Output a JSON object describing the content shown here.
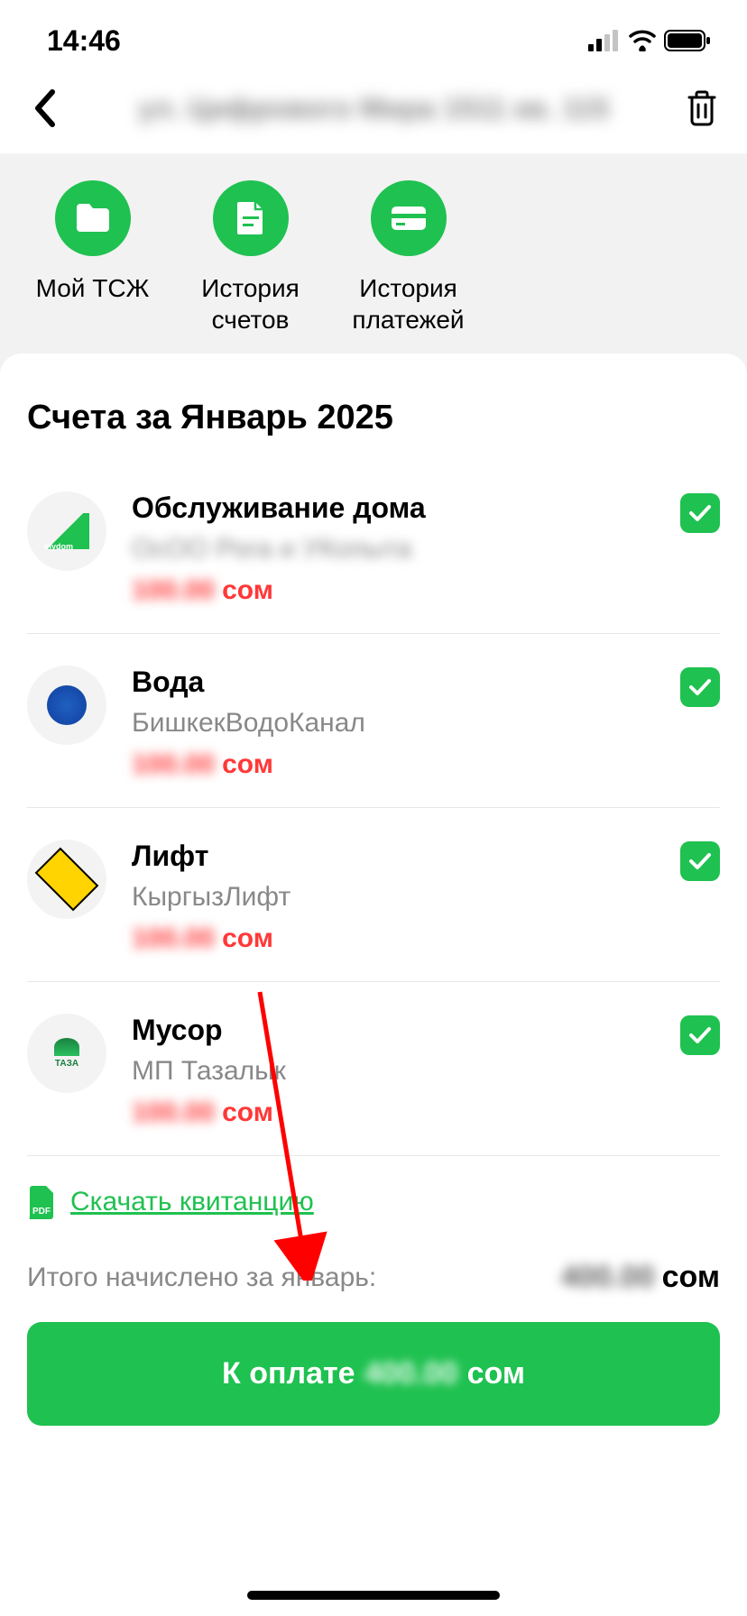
{
  "status": {
    "time": "14:46"
  },
  "header": {
    "title": "ул. Цифрового Мира 1511 кв. 115"
  },
  "actions": {
    "tsj": "Мой ТСЖ",
    "bills_history": "История счетов",
    "payments_history": "История платежей"
  },
  "section_title": "Счета за Январь 2025",
  "bills": [
    {
      "title": "Обслуживание дома",
      "provider": "ОсОО Рога и УКопыта",
      "amount": "100.00",
      "currency": "сом",
      "checked": true,
      "provider_blurred": true
    },
    {
      "title": "Вода",
      "provider": "БишкекВодоКанал",
      "amount": "100.00",
      "currency": "сом",
      "checked": true,
      "provider_blurred": false
    },
    {
      "title": "Лифт",
      "provider": "КыргызЛифт",
      "amount": "100.00",
      "currency": "сом",
      "checked": true,
      "provider_blurred": false
    },
    {
      "title": "Мусор",
      "provider": "МП Тазалык",
      "amount": "100.00",
      "currency": "сом",
      "checked": true,
      "provider_blurred": false
    }
  ],
  "download_label": "Скачать квитанцию",
  "total": {
    "label": "Итого начислено за январь:",
    "amount": "400.00",
    "currency": "сом"
  },
  "pay": {
    "prefix": "К оплате",
    "amount": "400.00",
    "currency": "сом"
  }
}
